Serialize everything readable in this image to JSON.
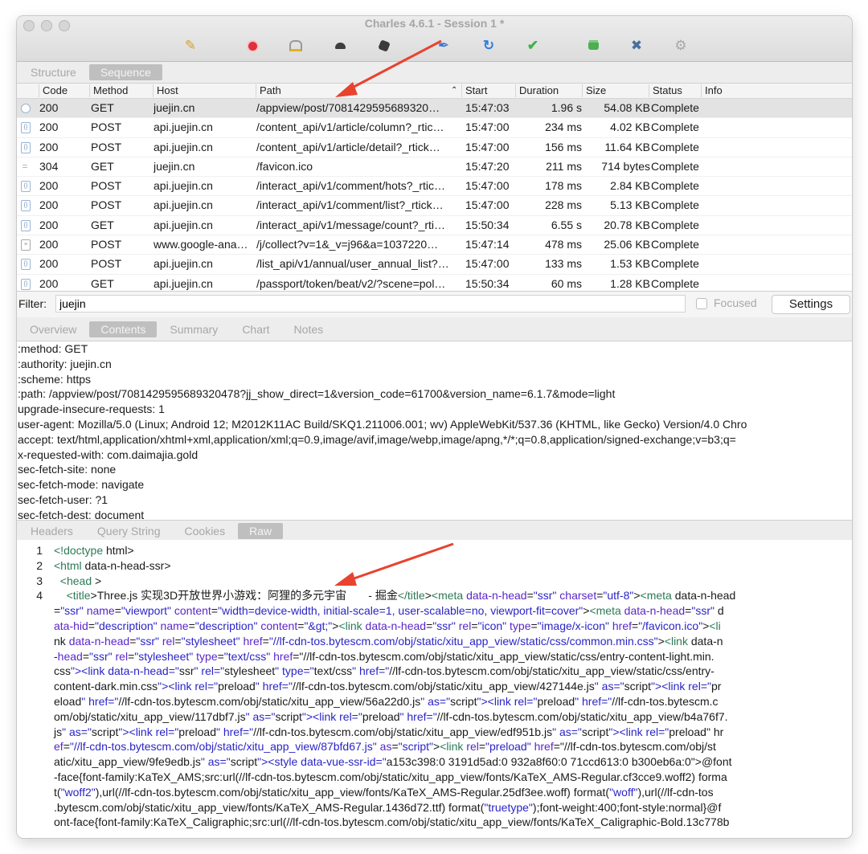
{
  "window": {
    "title": "Charles 4.6.1 - Session 1 *"
  },
  "toolbar": {
    "icons": [
      "broom-icon",
      "record-icon",
      "throttle-icon",
      "turtle-icon",
      "stop-icon",
      "pen-icon",
      "refresh-icon",
      "check-icon",
      "basket-icon",
      "tools-icon",
      "gear-icon"
    ]
  },
  "view_tabs": {
    "structure": "Structure",
    "sequence": "Sequence"
  },
  "table": {
    "headers": {
      "code": "Code",
      "method": "Method",
      "host": "Host",
      "path": "Path",
      "start": "Start",
      "duration": "Duration",
      "size": "Size",
      "status": "Status",
      "info": "Info"
    },
    "rows": [
      {
        "code": "200",
        "method": "GET",
        "host": "juejin.cn",
        "path": "/appview/post/7081429595689320…",
        "start": "15:47:03",
        "duration": "1.96 s",
        "size": "54.08 KB",
        "status": "Complete"
      },
      {
        "code": "200",
        "method": "POST",
        "host": "api.juejin.cn",
        "path": "/content_api/v1/article/column?_rtic…",
        "start": "15:47:00",
        "duration": "234 ms",
        "size": "4.02 KB",
        "status": "Complete"
      },
      {
        "code": "200",
        "method": "POST",
        "host": "api.juejin.cn",
        "path": "/content_api/v1/article/detail?_rtick…",
        "start": "15:47:00",
        "duration": "156 ms",
        "size": "11.64 KB",
        "status": "Complete"
      },
      {
        "code": "304",
        "method": "GET",
        "host": "juejin.cn",
        "path": "/favicon.ico",
        "start": "15:47:20",
        "duration": "211 ms",
        "size": "714 bytes",
        "status": "Complete"
      },
      {
        "code": "200",
        "method": "POST",
        "host": "api.juejin.cn",
        "path": "/interact_api/v1/comment/hots?_rtic…",
        "start": "15:47:00",
        "duration": "178 ms",
        "size": "2.84 KB",
        "status": "Complete"
      },
      {
        "code": "200",
        "method": "POST",
        "host": "api.juejin.cn",
        "path": "/interact_api/v1/comment/list?_rtick…",
        "start": "15:47:00",
        "duration": "228 ms",
        "size": "5.13 KB",
        "status": "Complete"
      },
      {
        "code": "200",
        "method": "GET",
        "host": "api.juejin.cn",
        "path": "/interact_api/v1/message/count?_rti…",
        "start": "15:50:34",
        "duration": "6.55 s",
        "size": "20.78 KB",
        "status": "Complete"
      },
      {
        "code": "200",
        "method": "POST",
        "host": "www.google-ana…",
        "path": "/j/collect?v=1&_v=j96&a=1037220…",
        "start": "15:47:14",
        "duration": "478 ms",
        "size": "25.06 KB",
        "status": "Complete"
      },
      {
        "code": "200",
        "method": "POST",
        "host": "api.juejin.cn",
        "path": "/list_api/v1/annual/user_annual_list?…",
        "start": "15:47:00",
        "duration": "133 ms",
        "size": "1.53 KB",
        "status": "Complete"
      },
      {
        "code": "200",
        "method": "GET",
        "host": "api.juejin.cn",
        "path": "/passport/token/beat/v2/?scene=pol…",
        "start": "15:50:34",
        "duration": "60 ms",
        "size": "1.28 KB",
        "status": "Complete"
      }
    ]
  },
  "filter": {
    "label": "Filter:",
    "value": "juejin",
    "focused_label": "Focused",
    "settings_label": "Settings"
  },
  "detail_tabs": {
    "overview": "Overview",
    "contents": "Contents",
    "summary": "Summary",
    "chart": "Chart",
    "notes": "Notes"
  },
  "request_headers": [
    ":method: GET",
    ":authority: juejin.cn",
    ":scheme: https",
    ":path: /appview/post/7081429595689320478?jj_show_direct=1&version_code=61700&version_name=6.1.7&mode=light",
    "upgrade-insecure-requests: 1",
    "user-agent: Mozilla/5.0 (Linux; Android 12; M2012K11AC Build/SKQ1.211006.001; wv) AppleWebKit/537.36 (KHTML, like Gecko) Version/4.0 Chro",
    "accept: text/html,application/xhtml+xml,application/xml;q=0.9,image/avif,image/webp,image/apng,*/*;q=0.8,application/signed-exchange;v=b3;q=",
    "x-requested-with: com.daimajia.gold",
    "sec-fetch-site: none",
    "sec-fetch-mode: navigate",
    "sec-fetch-user: ?1",
    "sec-fetch-dest: document"
  ],
  "response_tabs": {
    "headers": "Headers",
    "query_string": "Query String",
    "cookies": "Cookies",
    "raw": "Raw"
  },
  "raw_lines": [
    {
      "num": "1",
      "text": "<!doctype html>"
    },
    {
      "num": "2",
      "text": "<html data-n-head-ssr>"
    },
    {
      "num": "3",
      "text": "  <head >"
    },
    {
      "num": "4",
      "text": "    <title>Three.js 实现3D开放世界小游戏：阿狸的多元宇宙       - 掘金</title><meta data-n-head=\"ssr\" charset=\"utf-8\"><meta data-n-head"
    },
    {
      "num": "",
      "text": "=\"ssr\" name=\"viewport\" content=\"width=device-width, initial-scale=1, user-scalable=no, viewport-fit=cover\"><meta data-n-head=\"ssr\" d"
    },
    {
      "num": "",
      "text": "ata-hid=\"description\" name=\"description\" content=\"&gt;\"><link data-n-head=\"ssr\" rel=\"icon\" type=\"image/x-icon\" href=\"/favicon.ico\"><li"
    },
    {
      "num": "",
      "text": "nk data-n-head=\"ssr\" rel=\"stylesheet\" href=\"//lf-cdn-tos.bytescm.com/obj/static/xitu_app_view/static/css/common.min.css\"><link data-n"
    },
    {
      "num": "",
      "text": "-head=\"ssr\" rel=\"stylesheet\" type=\"text/css\" href=\"//lf-cdn-tos.bytescm.com/obj/static/xitu_app_view/static/css/entry-content-light.min."
    },
    {
      "num": "",
      "text": "css\"><link data-n-head=\"ssr\" rel=\"stylesheet\" type=\"text/css\" href=\"//lf-cdn-tos.bytescm.com/obj/static/xitu_app_view/static/css/entry-"
    },
    {
      "num": "",
      "text": "content-dark.min.css\"><link rel=\"preload\" href=\"//lf-cdn-tos.bytescm.com/obj/static/xitu_app_view/427144e.js\" as=\"script\"><link rel=\"pr"
    },
    {
      "num": "",
      "text": "eload\" href=\"//lf-cdn-tos.bytescm.com/obj/static/xitu_app_view/56a22d0.js\" as=\"script\"><link rel=\"preload\" href=\"//lf-cdn-tos.bytescm.c"
    },
    {
      "num": "",
      "text": "om/obj/static/xitu_app_view/117dbf7.js\" as=\"script\"><link rel=\"preload\" href=\"//lf-cdn-tos.bytescm.com/obj/static/xitu_app_view/b4a76f7."
    },
    {
      "num": "",
      "text": "js\" as=\"script\"><link rel=\"preload\" href=\"//lf-cdn-tos.bytescm.com/obj/static/xitu_app_view/edf951b.js\" as=\"script\"><link rel=\"preload\" hr"
    },
    {
      "num": "",
      "text": "ef=\"//lf-cdn-tos.bytescm.com/obj/static/xitu_app_view/87bfd67.js\" as=\"script\"><link rel=\"preload\" href=\"//lf-cdn-tos.bytescm.com/obj/st"
    },
    {
      "num": "",
      "text": "atic/xitu_app_view/9fe9edb.js\" as=\"script\"><style data-vue-ssr-id=\"a153c398:0 3191d5ad:0 932a8f60:0 71ccd613:0 b300eb6a:0\">@font"
    },
    {
      "num": "",
      "text": "-face{font-family:KaTeX_AMS;src:url(//lf-cdn-tos.bytescm.com/obj/static/xitu_app_view/fonts/KaTeX_AMS-Regular.cf3cce9.woff2) forma"
    },
    {
      "num": "",
      "text": "t(\"woff2\"),url(//lf-cdn-tos.bytescm.com/obj/static/xitu_app_view/fonts/KaTeX_AMS-Regular.25df3ee.woff) format(\"woff\"),url(//lf-cdn-tos"
    },
    {
      "num": "",
      "text": ".bytescm.com/obj/static/xitu_app_view/fonts/KaTeX_AMS-Regular.1436d72.ttf) format(\"truetype\");font-weight:400;font-style:normal}@f"
    },
    {
      "num": "",
      "text": "ont-face{font-family:KaTeX_Caligraphic;src:url(//lf-cdn-tos.bytescm.com/obj/static/xitu_app_view/fonts/KaTeX_Caligraphic-Bold.13c778b"
    }
  ],
  "colors": {
    "tag": "#2d7a56",
    "attr": "#5a26c8",
    "value": "#2a24c6",
    "arrow": "#e8432f"
  }
}
